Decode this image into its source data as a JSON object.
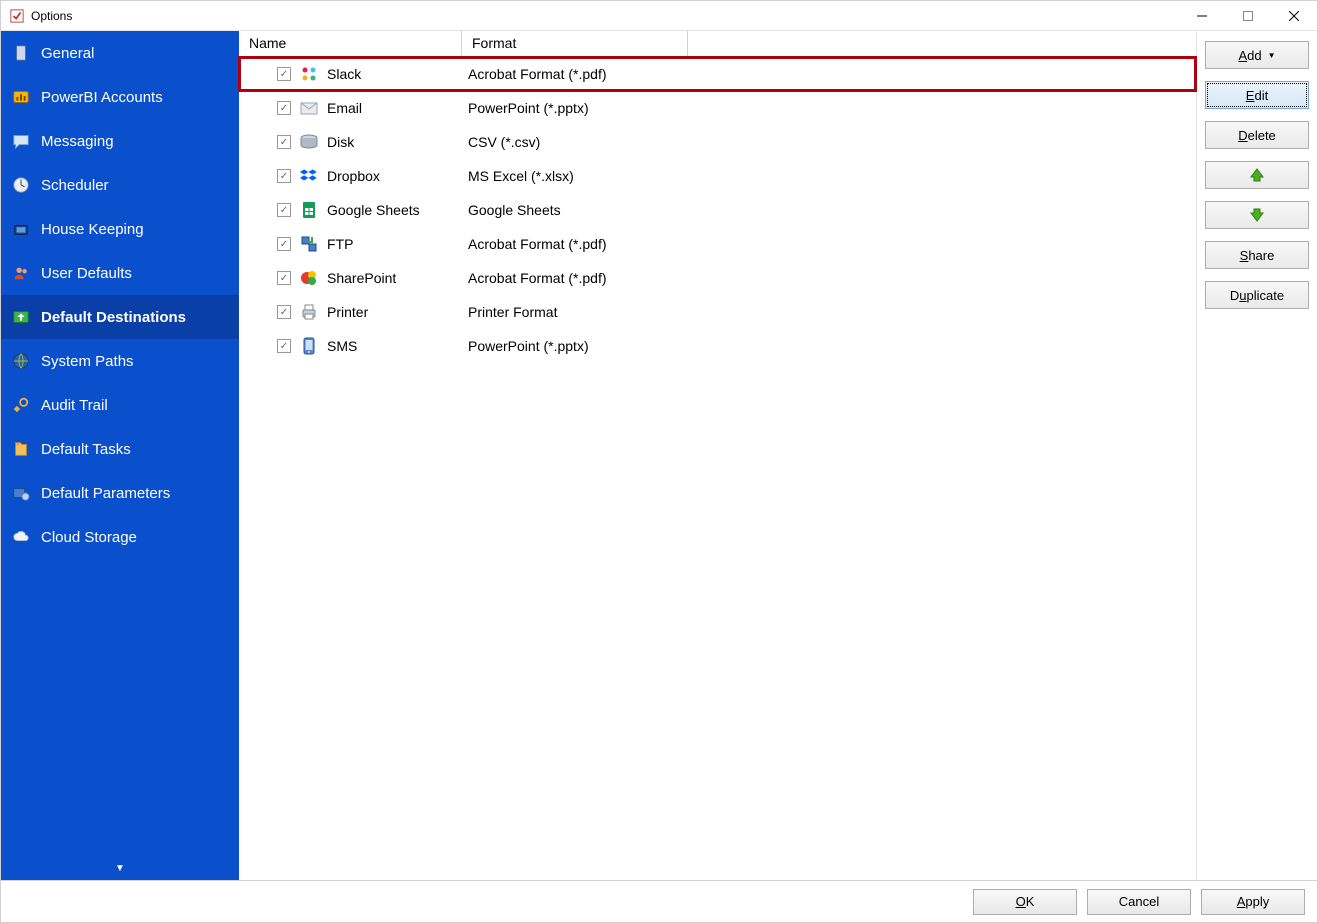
{
  "window": {
    "title": "Options"
  },
  "sidebar": {
    "items": [
      {
        "label": "General",
        "icon": "general"
      },
      {
        "label": "PowerBI Accounts",
        "icon": "powerbi"
      },
      {
        "label": "Messaging",
        "icon": "messaging"
      },
      {
        "label": "Scheduler",
        "icon": "scheduler"
      },
      {
        "label": "House Keeping",
        "icon": "housekeeping"
      },
      {
        "label": "User Defaults",
        "icon": "userdefaults"
      },
      {
        "label": "Default Destinations",
        "icon": "destinations"
      },
      {
        "label": "System Paths",
        "icon": "systempaths"
      },
      {
        "label": "Audit Trail",
        "icon": "audittrail"
      },
      {
        "label": "Default Tasks",
        "icon": "defaulttasks"
      },
      {
        "label": "Default Parameters",
        "icon": "defaultparams"
      },
      {
        "label": "Cloud Storage",
        "icon": "cloudstorage"
      }
    ],
    "active_index": 6
  },
  "table": {
    "columns": {
      "name": "Name",
      "format": "Format"
    },
    "rows": [
      {
        "name": "Slack",
        "format": "Acrobat Format (*.pdf)",
        "icon": "slack",
        "checked": true,
        "highlighted": true
      },
      {
        "name": "Email",
        "format": "PowerPoint (*.pptx)",
        "icon": "email",
        "checked": true
      },
      {
        "name": "Disk",
        "format": "CSV (*.csv)",
        "icon": "disk",
        "checked": true
      },
      {
        "name": "Dropbox",
        "format": "MS Excel (*.xlsx)",
        "icon": "dropbox",
        "checked": true
      },
      {
        "name": "Google Sheets",
        "format": "Google Sheets",
        "icon": "gsheets",
        "checked": true
      },
      {
        "name": "FTP",
        "format": "Acrobat Format (*.pdf)",
        "icon": "ftp",
        "checked": true
      },
      {
        "name": "SharePoint",
        "format": "Acrobat Format (*.pdf)",
        "icon": "sharepoint",
        "checked": true
      },
      {
        "name": "Printer",
        "format": "Printer Format",
        "icon": "printer",
        "checked": true
      },
      {
        "name": "SMS",
        "format": "PowerPoint (*.pptx)",
        "icon": "sms",
        "checked": true
      }
    ]
  },
  "panel": {
    "add": "Add",
    "edit": "Edit",
    "delete": "Delete",
    "share": "Share",
    "duplicate": "Duplicate"
  },
  "footer": {
    "ok": "OK",
    "cancel": "Cancel",
    "apply": "Apply"
  }
}
